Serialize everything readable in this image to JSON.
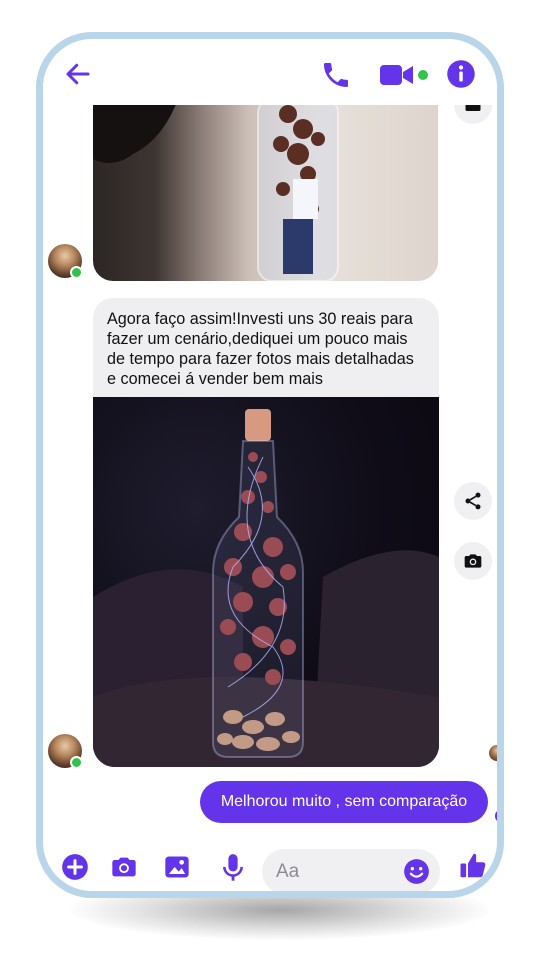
{
  "header": {
    "icons": [
      "arrow-left-icon",
      "phone-icon",
      "video-camera-icon",
      "info-icon"
    ],
    "accent_color": "#6334e9",
    "online_color": "#31c44a"
  },
  "messages": [
    {
      "type": "image",
      "from": "contact",
      "description_icon": "image-icon"
    },
    {
      "type": "text",
      "from": "contact",
      "text": "Agora faço assim!Investi uns 30 reais para fazer um cenário,dediquei um pouco mais de tempo para fazer fotos mais detalhadas e comecei á vender bem mais"
    },
    {
      "type": "image",
      "from": "contact",
      "description_icon": "image-icon"
    },
    {
      "type": "text",
      "from": "me",
      "text": "Melhorou muito , sem comparação"
    }
  ],
  "composer": {
    "placeholder": "Aa",
    "icons": [
      "plus-icon",
      "camera-icon",
      "gallery-icon",
      "microphone-icon",
      "emoji-icon",
      "thumbs-up-icon"
    ]
  },
  "side_actions": [
    "share-icon",
    "camera-icon"
  ]
}
